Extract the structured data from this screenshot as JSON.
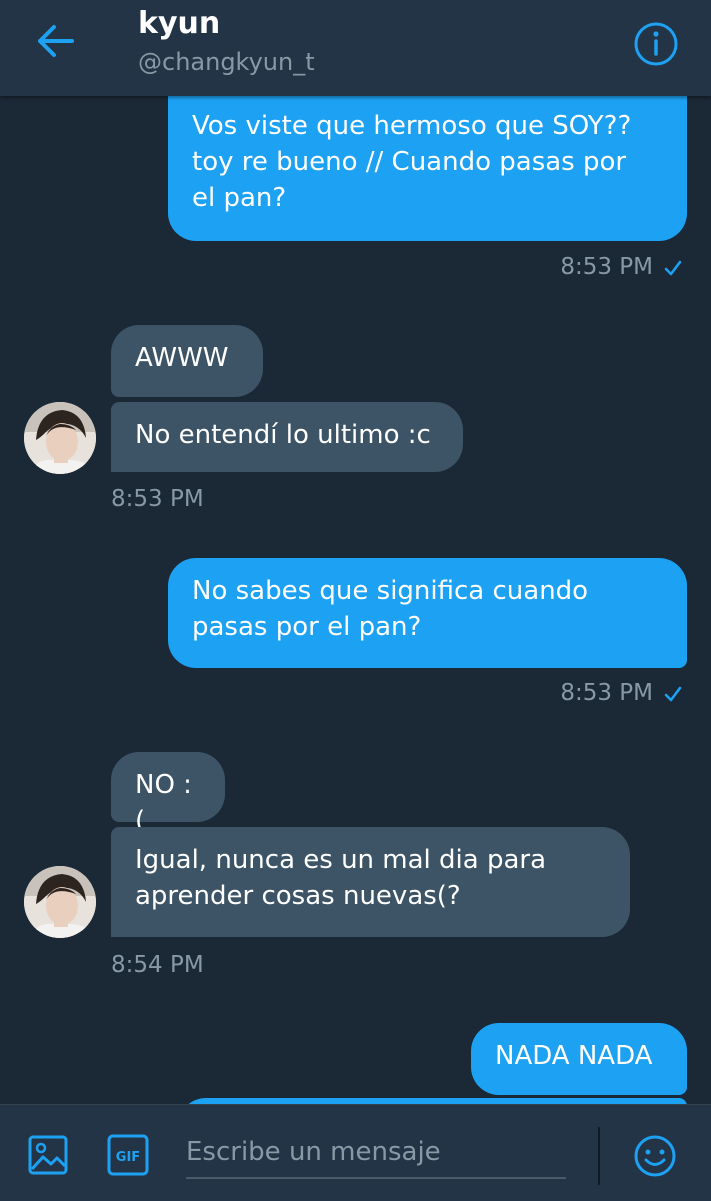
{
  "header": {
    "title": "kyun",
    "handle": "@changkyun_t"
  },
  "messages": [
    {
      "text": "Vos viste que hermoso que SOY?? toy re bueno // Cuando pasas por el pan?",
      "lines": [
        "Vos viste que hermoso que SOY??",
        "toy re bueno // Cuando pasas por",
        "el pan?"
      ],
      "time": "8:53 PM"
    },
    {
      "text": "AWWW"
    },
    {
      "text": "No entendí lo ultimo :c",
      "time": "8:53 PM"
    },
    {
      "lines": [
        "No sabes que significa cuando",
        "pasas por el pan?"
      ],
      "time": "8:53 PM"
    },
    {
      "text": "NO :("
    },
    {
      "lines": [
        "Igual, nunca es un mal dia para",
        "aprender cosas nuevas(?"
      ],
      "time": "8:54 PM"
    },
    {
      "text": "NADA NADA"
    }
  ],
  "composer": {
    "placeholder": "Escribe un mensaje",
    "gif_label": "GIF"
  },
  "colors": {
    "background": "#1b2836",
    "header": "#243447",
    "outgoing": "#1da1f2",
    "incoming": "#3d5466",
    "accent": "#1da1f2"
  },
  "icons": [
    "back-arrow-icon",
    "info-icon",
    "read-check-icon",
    "image-icon",
    "gif-icon",
    "emoji-icon"
  ]
}
